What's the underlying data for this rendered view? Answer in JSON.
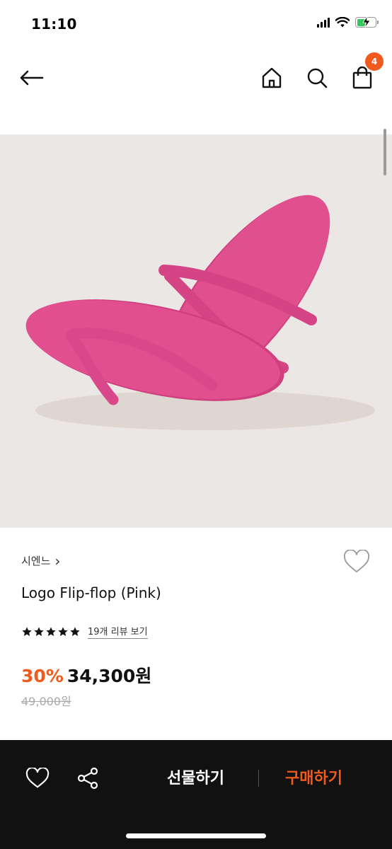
{
  "status_bar": {
    "time": "11:10"
  },
  "nav": {
    "cart_count": "4"
  },
  "product": {
    "brand": "시엔느",
    "brand_chevron": "›",
    "name": "Logo Flip-flop (Pink)",
    "rating": 5,
    "review_link": "19개 리뷰 보기",
    "discount": "30%",
    "price": "34,300원",
    "original_price": "49,000원"
  },
  "bottom_bar": {
    "gift_label": "선물하기",
    "buy_label": "구매하기"
  },
  "colors": {
    "accent": "#f05a1e",
    "flipflop": "#e0508f",
    "image_bg": "#ebe7e4",
    "bottom_bar_bg": "#111111"
  },
  "icons": [
    "back-arrow-icon",
    "home-icon",
    "search-icon",
    "shopping-bag-icon",
    "heart-icon",
    "share-icon",
    "star-icon"
  ]
}
